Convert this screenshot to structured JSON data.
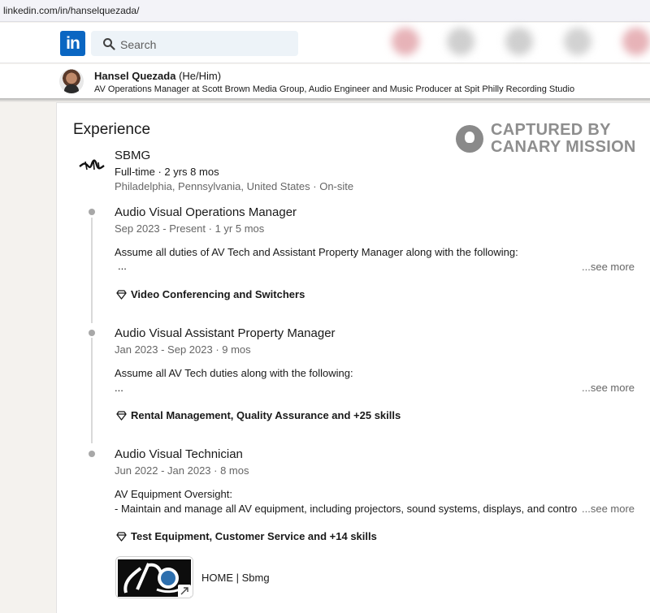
{
  "browser": {
    "url": "linkedin.com/in/hanselquezada/"
  },
  "topnav": {
    "logo_text": "in",
    "search_placeholder": "Search",
    "logo_color": "#0a66c2"
  },
  "profile": {
    "name": "Hansel Quezada",
    "pronouns": "(He/Him)",
    "headline": "AV Operations Manager at Scott Brown Media Group, Audio Engineer and Music Producer at Spit Philly Recording Studio"
  },
  "watermark": {
    "line1": "CAPTURED BY",
    "line2": "CANARY MISSION"
  },
  "experience": {
    "title": "Experience",
    "company": {
      "name": "SBMG",
      "tenure": "Full-time · 2 yrs 8 mos",
      "location": "Philadelphia, Pennsylvania, United States · On-site"
    },
    "roles": [
      {
        "title": "Audio Visual Operations Manager",
        "dates": "Sep 2023 - Present · 1 yr 5 mos",
        "desc_line1": "Assume all duties of AV Tech and Assistant Property Manager along with the following:",
        "desc_line2": "...",
        "see_more": "...see more",
        "skills": "Video Conferencing and Switchers"
      },
      {
        "title": "Audio Visual Assistant Property Manager",
        "dates": "Jan 2023 - Sep 2023 · 9 mos",
        "desc_line1": "Assume all AV Tech duties along with the following:",
        "desc_line2": "...",
        "see_more": "...see more",
        "skills": "Rental Management, Quality Assurance and +25 skills"
      },
      {
        "title": "Audio Visual Technician",
        "dates": "Jun 2022 - Jan 2023 · 8 mos",
        "desc_line1": "AV Equipment Oversight:",
        "desc_line2": "- Maintain and manage all AV equipment, including projectors, sound systems, displays, and control s",
        "see_more": "...see more",
        "skills": "Test Equipment, Customer Service and +14 skills"
      }
    ],
    "media": {
      "label": "HOME | Sbmg",
      "icon": "external-link-icon"
    }
  }
}
